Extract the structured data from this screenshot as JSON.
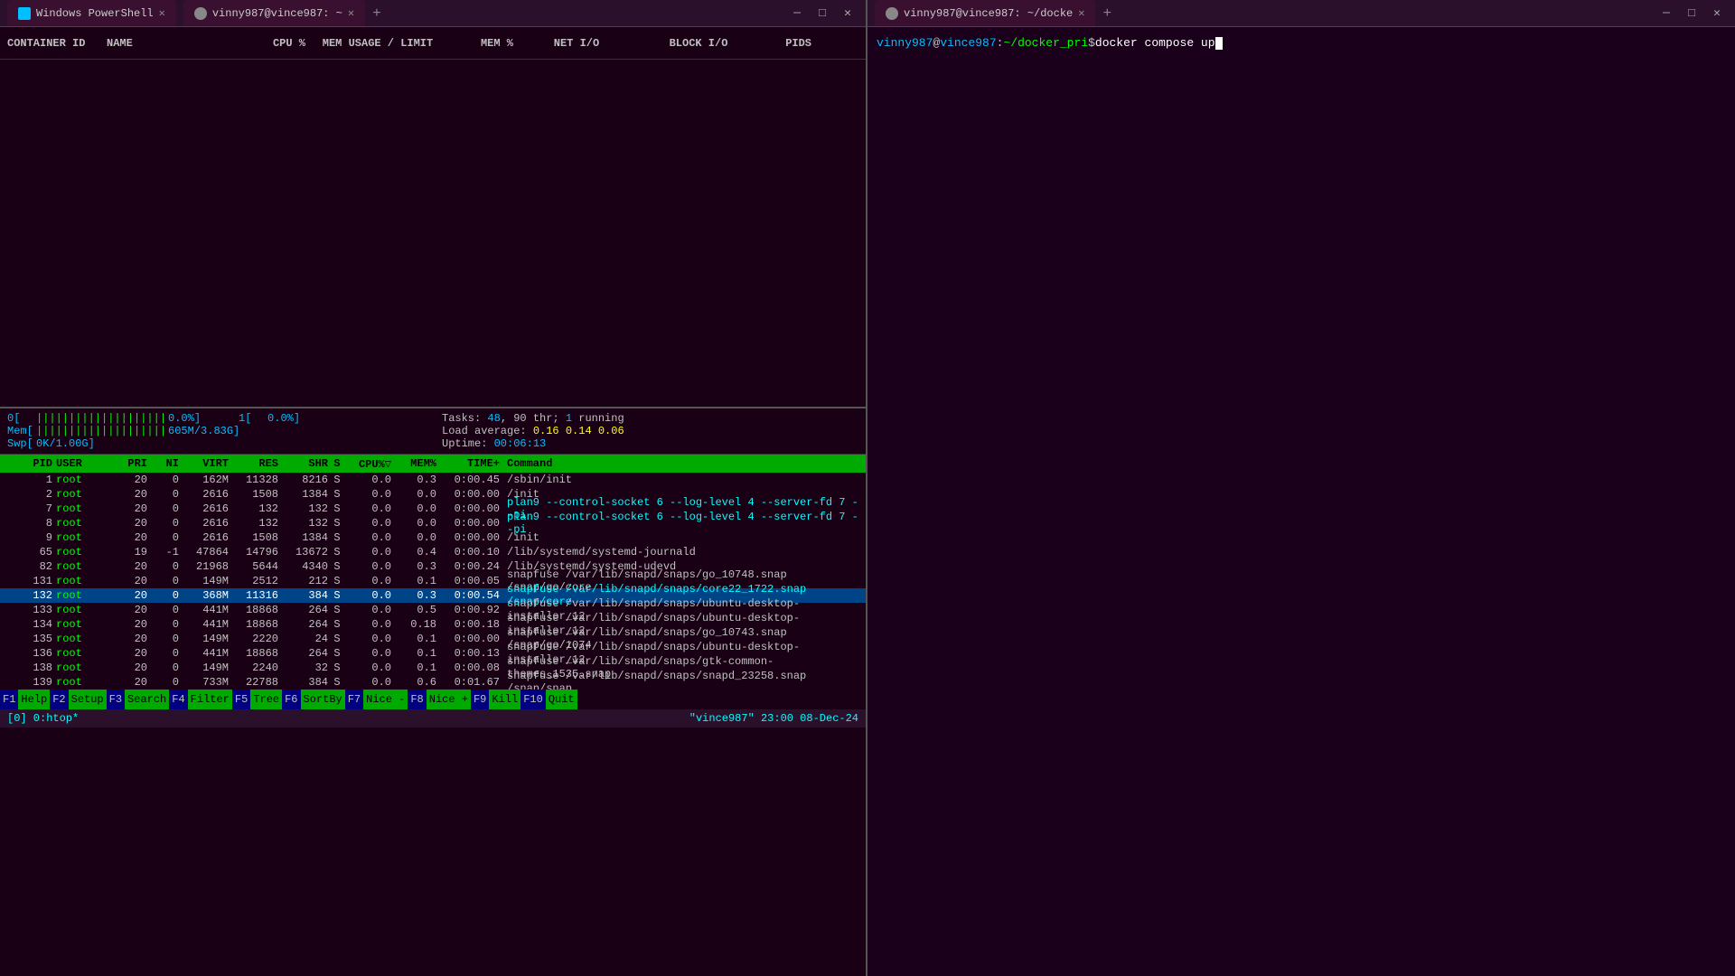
{
  "windows": {
    "left": {
      "tab1_label": "Windows PowerShell",
      "tab2_label": "vinny987@vince987: ~",
      "icon1": "PS",
      "icon2": "T"
    },
    "right": {
      "tab1_label": "vinny987@vince987: ~/docke",
      "icon": "T"
    }
  },
  "docker_stats": {
    "headers": [
      "CONTAINER ID",
      "NAME",
      "CPU %",
      "MEM USAGE / LIMIT",
      "MEM %",
      "NET I/O",
      "BLOCK I/O",
      "PIDS"
    ],
    "rows": []
  },
  "htop": {
    "cpu0": {
      "label": "0[",
      "bar": "||||||||||||||||||||",
      "value": "0.0%]"
    },
    "cpu1": {
      "label": "1[",
      "bar": "",
      "value": "0.0%]"
    },
    "mem": {
      "label": "Mem[",
      "bar": "||||||||||||||||||||",
      "value": "605M/3.83G]"
    },
    "swp": {
      "label": "Swp[",
      "bar": "",
      "value": "0K/1.00G]"
    },
    "tasks": "Tasks: 48, 90 thr; 1 running",
    "load_avg": "Load average: 0.16 0.14 0.06",
    "uptime": "Uptime: 00:06:13",
    "table_headers": [
      "PID",
      "USER",
      "PRI",
      "NI",
      "VIRT",
      "RES",
      "SHR",
      "S",
      "CPU%",
      "MEM%",
      "TIME+",
      "Command"
    ],
    "processes": [
      {
        "pid": "1",
        "user": "root",
        "pri": "20",
        "ni": "0",
        "virt": "162M",
        "res": "11328",
        "shr": "8216",
        "s": "S",
        "cpu": "0.0",
        "mem": "0.3",
        "time": "0:00.45",
        "cmd": "/sbin/init",
        "highlight": false
      },
      {
        "pid": "2",
        "user": "root",
        "pri": "20",
        "ni": "0",
        "virt": "2616",
        "res": "1508",
        "shr": "1384",
        "s": "S",
        "cpu": "0.0",
        "mem": "0.0",
        "time": "0:00.00",
        "cmd": "/init",
        "highlight": false
      },
      {
        "pid": "7",
        "user": "root",
        "pri": "20",
        "ni": "0",
        "virt": "2616",
        "res": "132",
        "shr": "132",
        "s": "S",
        "cpu": "0.0",
        "mem": "0.0",
        "time": "0:00.00",
        "cmd": "plan9 --control-socket 6 --log-level 4 --server-fd 7 --pi",
        "highlight": false,
        "cmd_color": "cyan"
      },
      {
        "pid": "8",
        "user": "root",
        "pri": "20",
        "ni": "0",
        "virt": "2616",
        "res": "132",
        "shr": "132",
        "s": "S",
        "cpu": "0.0",
        "mem": "0.0",
        "time": "0:00.00",
        "cmd": "plan9 --control-socket 6 --log-level 4 --server-fd 7 --pi",
        "highlight": false,
        "cmd_color": "cyan"
      },
      {
        "pid": "9",
        "user": "root",
        "pri": "20",
        "ni": "0",
        "virt": "2616",
        "res": "1508",
        "shr": "1384",
        "s": "S",
        "cpu": "0.0",
        "mem": "0.0",
        "time": "0:00.00",
        "cmd": "/init",
        "highlight": false
      },
      {
        "pid": "65",
        "user": "root",
        "pri": "19",
        "ni": "-1",
        "virt": "47864",
        "res": "14796",
        "shr": "13672",
        "s": "S",
        "cpu": "0.0",
        "mem": "0.4",
        "time": "0:00.10",
        "cmd": "/lib/systemd/systemd-journald",
        "highlight": false
      },
      {
        "pid": "82",
        "user": "root",
        "pri": "20",
        "ni": "0",
        "virt": "21968",
        "res": "5644",
        "shr": "4340",
        "s": "S",
        "cpu": "0.0",
        "mem": "0.3",
        "time": "0:00.24",
        "cmd": "/lib/systemd/systemd-udevd",
        "highlight": false
      },
      {
        "pid": "131",
        "user": "root",
        "pri": "20",
        "ni": "0",
        "virt": "149M",
        "res": "2512",
        "shr": "212",
        "s": "S",
        "cpu": "0.0",
        "mem": "0.1",
        "time": "0:00.05",
        "cmd": "snapfuse /var/lib/snapd/snaps/go_10748.snap /snap/go/core",
        "highlight": false
      },
      {
        "pid": "132",
        "user": "root",
        "pri": "20",
        "ni": "0",
        "virt": "368M",
        "res": "11316",
        "shr": "384",
        "s": "S",
        "cpu": "0.0",
        "mem": "0.3",
        "time": "0:00.54",
        "cmd": "snapfuse /var/lib/snapd/snaps/core22_1722.snap /snap/core",
        "highlight": true
      },
      {
        "pid": "133",
        "user": "root",
        "pri": "20",
        "ni": "0",
        "virt": "441M",
        "res": "18868",
        "shr": "264",
        "s": "S",
        "cpu": "0.0",
        "mem": "0.5",
        "time": "0:00.92",
        "cmd": "snapfuse /var/lib/snapd/snaps/ubuntu-desktop-installer_12",
        "highlight": false
      },
      {
        "pid": "134",
        "user": "root",
        "pri": "20",
        "ni": "0",
        "virt": "441M",
        "res": "18868",
        "shr": "264",
        "s": "S",
        "cpu": "0.0",
        "mem": "0.18",
        "time": "0:00.18",
        "cmd": "snapfuse /var/lib/snapd/snaps/ubuntu-desktop-installer_12",
        "highlight": false
      },
      {
        "pid": "135",
        "user": "root",
        "pri": "20",
        "ni": "0",
        "virt": "149M",
        "res": "2220",
        "shr": "24",
        "s": "S",
        "cpu": "0.0",
        "mem": "0.1",
        "time": "0:00.00",
        "cmd": "snapfuse /var/lib/snapd/snaps/go_10743.snap /snap/go/1074",
        "highlight": false
      },
      {
        "pid": "136",
        "user": "root",
        "pri": "20",
        "ni": "0",
        "virt": "441M",
        "res": "18868",
        "shr": "264",
        "s": "S",
        "cpu": "0.0",
        "mem": "0.1",
        "time": "0:00.13",
        "cmd": "snapfuse /var/lib/snapd/snaps/ubuntu-desktop-installer_12",
        "highlight": false
      },
      {
        "pid": "138",
        "user": "root",
        "pri": "20",
        "ni": "0",
        "virt": "149M",
        "res": "2240",
        "shr": "32",
        "s": "S",
        "cpu": "0.0",
        "mem": "0.1",
        "time": "0:00.08",
        "cmd": "snapfuse /var/lib/snapd/snaps/gtk-common-themes_1535.snap",
        "highlight": false
      },
      {
        "pid": "139",
        "user": "root",
        "pri": "20",
        "ni": "0",
        "virt": "733M",
        "res": "22788",
        "shr": "384",
        "s": "S",
        "cpu": "0.0",
        "mem": "0.6",
        "time": "0:01.67",
        "cmd": "snapfuse /var/lib/snapd/snaps/snapd_23258.snap /snap/snap",
        "highlight": false
      }
    ],
    "footer_items": [
      {
        "num": "F1",
        "label": "Help"
      },
      {
        "num": "F2",
        "label": "Setup"
      },
      {
        "num": "F3",
        "label": "Search"
      },
      {
        "num": "F4",
        "label": "Filter"
      },
      {
        "num": "F5",
        "label": "Tree"
      },
      {
        "num": "F6",
        "label": "SortBy"
      },
      {
        "num": "F7",
        "label": "Nice -"
      },
      {
        "num": "F8",
        "label": "Nice +"
      },
      {
        "num": "F9",
        "label": "Kill"
      },
      {
        "num": "F10",
        "label": "Quit"
      }
    ],
    "status_left": "[0] 0:htop*",
    "status_right": "\"vince987\" 23:00 08-Dec-24"
  },
  "right_terminal": {
    "prompt_user": "vinny987",
    "prompt_at": "@",
    "prompt_host": "vince987",
    "prompt_colon": ":",
    "prompt_path": "~/docker_pri",
    "prompt_dollar": "$",
    "prompt_cmd": " docker compose up "
  }
}
